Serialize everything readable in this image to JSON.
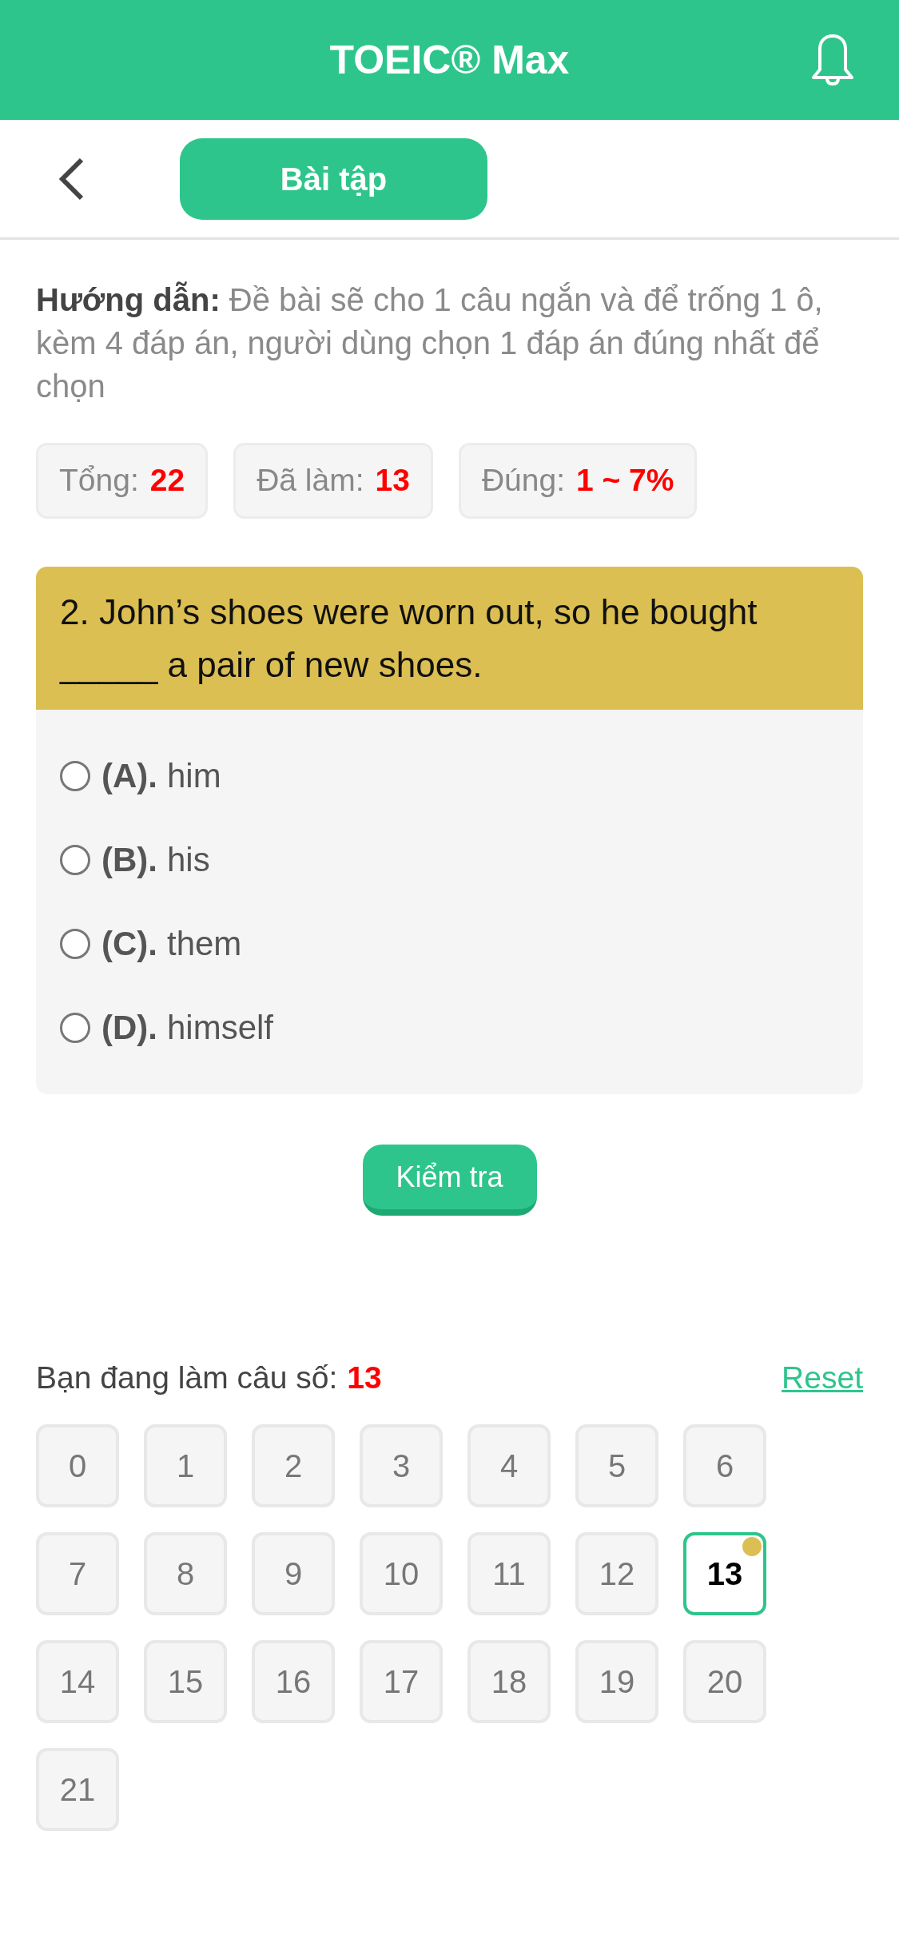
{
  "header": {
    "title": "TOEIC® Max"
  },
  "toolbar": {
    "tab": "Bài tập"
  },
  "instructions": "**Hướng dẫn:** Đề bài sẽ cho 1 câu ngắn và để trống 1 ô, kèm 4 đáp án, người dùng chọn 1 đáp án đúng nhất để chọn",
  "stats": [
    {
      "label": "Tổng:",
      "value": "22"
    },
    {
      "label": "Đã làm:",
      "value": "13"
    },
    {
      "label": "Đúng:",
      "value": "1 ~ 7%"
    }
  ],
  "question": {
    "text": "2. John’s shoes were worn out, so he bought _____ a pair of new shoes.",
    "options": [
      {
        "letter": "(A).",
        "text": "him",
        "selected": false
      },
      {
        "letter": "(B).",
        "text": "his",
        "selected": false
      },
      {
        "letter": "(C).",
        "text": "them",
        "selected": false
      },
      {
        "letter": "(D).",
        "text": "himself",
        "selected": false
      }
    ]
  },
  "check_button": "Kiểm tra",
  "progress": {
    "label": "Bạn đang làm câu số:",
    "current": "13",
    "reset": "Reset"
  },
  "question_grid": [
    {
      "number": "0",
      "selected": false,
      "marked": false
    },
    {
      "number": "1",
      "selected": false,
      "marked": false
    },
    {
      "number": "2",
      "selected": false,
      "marked": false
    },
    {
      "number": "3",
      "selected": false,
      "marked": false
    },
    {
      "number": "4",
      "selected": false,
      "marked": false
    },
    {
      "number": "5",
      "selected": false,
      "marked": false
    },
    {
      "number": "6",
      "selected": false,
      "marked": false
    },
    {
      "number": "7",
      "selected": false,
      "marked": false
    },
    {
      "number": "8",
      "selected": false,
      "marked": false
    },
    {
      "number": "9",
      "selected": false,
      "marked": false
    },
    {
      "number": "10",
      "selected": false,
      "marked": false
    },
    {
      "number": "11",
      "selected": false,
      "marked": false
    },
    {
      "number": "12",
      "selected": false,
      "marked": false
    },
    {
      "number": "13",
      "selected": true,
      "marked": true
    },
    {
      "number": "14",
      "selected": false,
      "marked": false
    },
    {
      "number": "15",
      "selected": false,
      "marked": false
    },
    {
      "number": "16",
      "selected": false,
      "marked": false
    },
    {
      "number": "17",
      "selected": false,
      "marked": false
    },
    {
      "number": "18",
      "selected": false,
      "marked": false
    },
    {
      "number": "19",
      "selected": false,
      "marked": false
    },
    {
      "number": "20",
      "selected": false,
      "marked": false
    },
    {
      "number": "21",
      "selected": false,
      "marked": false
    }
  ]
}
